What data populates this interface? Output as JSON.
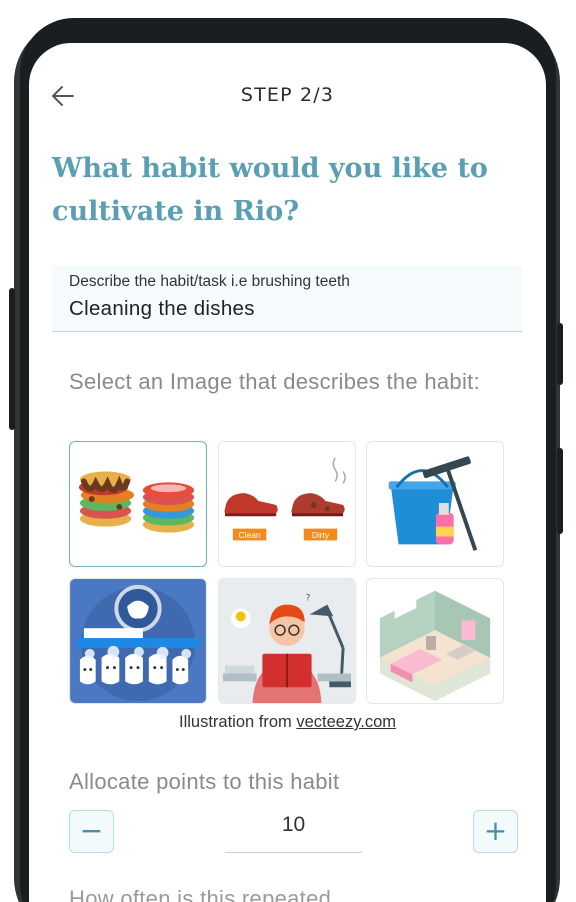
{
  "header": {
    "step_label": "STEP 2/3"
  },
  "question": "What habit would you like to cultivate in Rio?",
  "habit_field": {
    "label": "Describe the habit/task i.e brushing teeth",
    "value": "Cleaning the dishes"
  },
  "image_select": {
    "title": "Select an Image that describes the habit:",
    "images": [
      {
        "name": "dishes-illustration",
        "selected": true
      },
      {
        "name": "shoes-illustration",
        "selected": false,
        "labels": [
          "Clean",
          "Dirty"
        ]
      },
      {
        "name": "cleaning-bucket-illustration",
        "selected": false
      },
      {
        "name": "brushing-teeth-illustration",
        "selected": false
      },
      {
        "name": "reading-illustration",
        "selected": false
      },
      {
        "name": "bedroom-illustration",
        "selected": false
      }
    ],
    "credit_prefix": "Illustration from ",
    "credit_link": "vecteezy.com"
  },
  "points": {
    "title": "Allocate points to this habit",
    "value": "10",
    "minus_label": "−",
    "plus_label": "+"
  },
  "repeat": {
    "title": "How often is this repeated"
  },
  "colors": {
    "accent": "#5a9fb3",
    "frame": "#2f3437"
  }
}
